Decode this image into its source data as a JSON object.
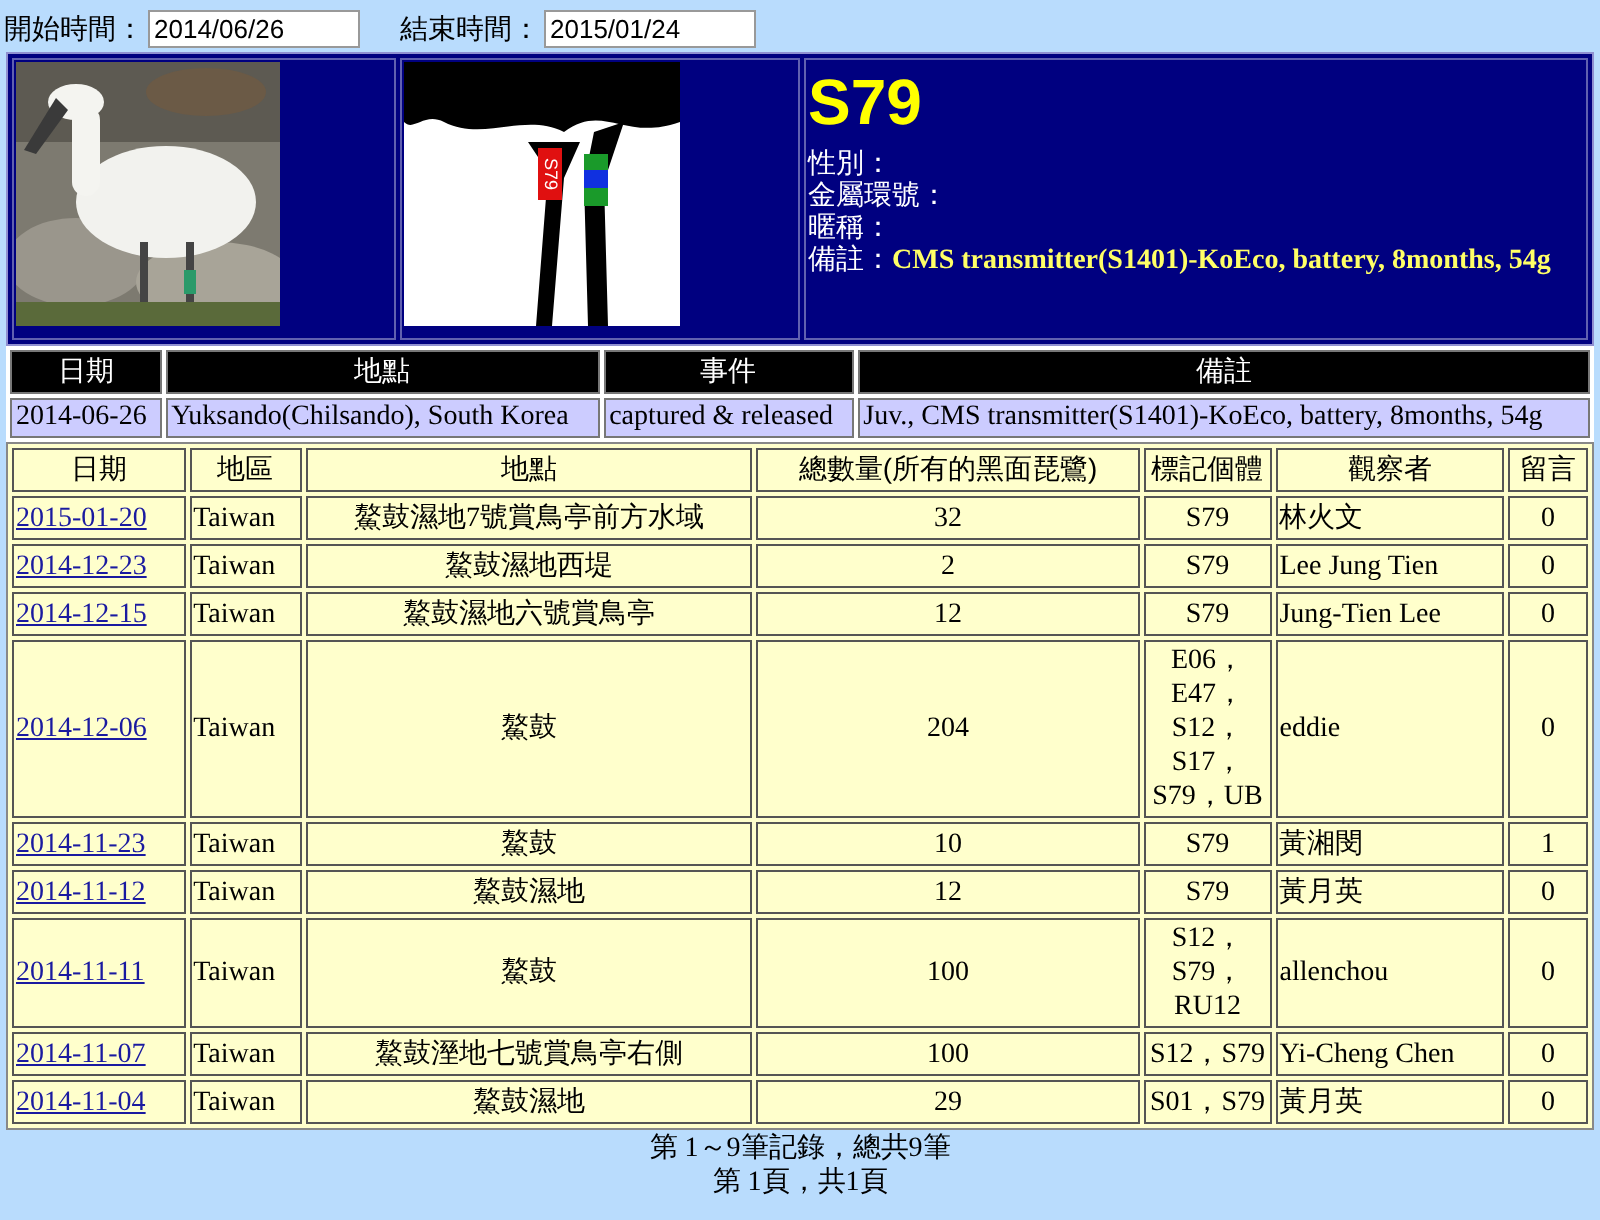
{
  "filters": [
    {
      "label": "開始時間：",
      "value": "2014/06/26"
    },
    {
      "label": "結束時間：",
      "value": "2015/01/24"
    }
  ],
  "bird": {
    "band_label": "S79",
    "name": "S79",
    "fields": [
      {
        "label": "性別："
      },
      {
        "label": "金屬環號："
      },
      {
        "label": "暱稱："
      },
      {
        "label": "備註：",
        "value": "CMS transmitter(S1401)-KoEco, battery, 8months, 54g"
      }
    ]
  },
  "banding": {
    "columns": [
      "日期",
      "地點",
      "事件",
      "備註"
    ],
    "rows": [
      [
        "2014-06-26",
        "Yuksando(Chilsando), South Korea",
        "captured & released",
        "Juv., CMS transmitter(S1401)-KoEco, battery, 8months, 54g"
      ]
    ]
  },
  "sightings": {
    "columns": [
      "日期",
      "地區",
      "地點",
      "總數量(所有的黑面琵鷺)",
      "標記個體",
      "觀察者",
      "留言"
    ],
    "rows": [
      {
        "date": "2015-01-20",
        "region": "Taiwan",
        "place": "鰲鼓濕地7號賞鳥亭前方水域",
        "count": "32",
        "tags": "S79",
        "observer": "林火文",
        "comments": "0"
      },
      {
        "date": "2014-12-23",
        "region": "Taiwan",
        "place": "鰲鼓濕地西堤",
        "count": "2",
        "tags": "S79",
        "observer": "Lee Jung Tien",
        "comments": "0"
      },
      {
        "date": "2014-12-15",
        "region": "Taiwan",
        "place": "鰲鼓濕地六號賞鳥亭",
        "count": "12",
        "tags": "S79",
        "observer": "Jung-Tien Lee",
        "comments": "0"
      },
      {
        "date": "2014-12-06",
        "region": "Taiwan",
        "place": "鰲鼓",
        "count": "204",
        "tags": "E06，E47，S12，S17，S79，UB",
        "observer": "eddie",
        "comments": "0"
      },
      {
        "date": "2014-11-23",
        "region": "Taiwan",
        "place": "鰲鼓",
        "count": "10",
        "tags": "S79",
        "observer": "黃湘閔",
        "comments": "1"
      },
      {
        "date": "2014-11-12",
        "region": "Taiwan",
        "place": "鰲鼓濕地",
        "count": "12",
        "tags": "S79",
        "observer": "黃月英",
        "comments": "0"
      },
      {
        "date": "2014-11-11",
        "region": "Taiwan",
        "place": "鰲鼓",
        "count": "100",
        "tags": "S12，S79，RU12",
        "observer": "allenchou",
        "comments": "0"
      },
      {
        "date": "2014-11-07",
        "region": "Taiwan",
        "place": "鰲鼓溼地七號賞鳥亭右側",
        "count": "100",
        "tags": "S12，S79",
        "observer": "Yi-Cheng Chen",
        "comments": "0"
      },
      {
        "date": "2014-11-04",
        "region": "Taiwan",
        "place": "鰲鼓濕地",
        "count": "29",
        "tags": "S01，S79",
        "observer": "黃月英",
        "comments": "0"
      }
    ]
  },
  "footer": [
    "第 1～9筆記錄，總共9筆",
    "第 1頁，共1頁"
  ]
}
